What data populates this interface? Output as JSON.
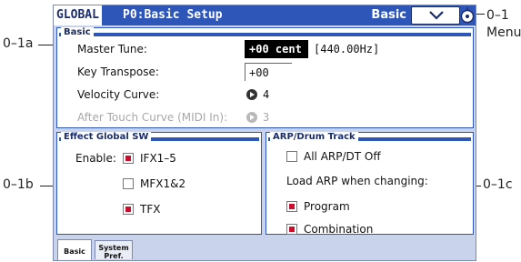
{
  "callouts": {
    "c01": "0–1",
    "menu": "Menu",
    "c01a": "0–1a",
    "c01b": "0–1b",
    "c01c": "0–1c"
  },
  "titlebar": {
    "mode": "GLOBAL",
    "page": "P0:Basic Setup",
    "tab": "Basic",
    "menu_icon": "chevron-down-icon",
    "knob_icon": "page-select-knob-icon"
  },
  "basic": {
    "header": "Basic",
    "master_tune_label": "Master Tune:",
    "master_tune_value": "+00 cent",
    "master_tune_hz": "[440.00Hz]",
    "key_transpose_label": "Key Transpose:",
    "key_transpose_value": "+00",
    "velocity_curve_label": "Velocity Curve:",
    "velocity_curve_value": "4",
    "aftertouch_label": "After Touch Curve (MIDI In):",
    "aftertouch_value": "3"
  },
  "effect": {
    "header": "Effect Global SW",
    "enable_label": "Enable:",
    "items": [
      {
        "label": "IFX1–5",
        "checked": true
      },
      {
        "label": "MFX1&2",
        "checked": false
      },
      {
        "label": "TFX",
        "checked": true
      }
    ]
  },
  "arp": {
    "header": "ARP/Drum Track",
    "all_off_label": "All ARP/DT Off",
    "all_off_checked": false,
    "load_label": "Load ARP when changing:",
    "items": [
      {
        "label": "Program",
        "checked": true
      },
      {
        "label": "Combination",
        "checked": true
      }
    ]
  },
  "tabs": [
    {
      "line1": "Basic",
      "line2": ""
    },
    {
      "line1": "System",
      "line2": "Pref."
    }
  ],
  "colors": {
    "title_bar": "#2d56b8",
    "screen_bg": "#c9d3ec",
    "check_red": "#c8102e"
  }
}
